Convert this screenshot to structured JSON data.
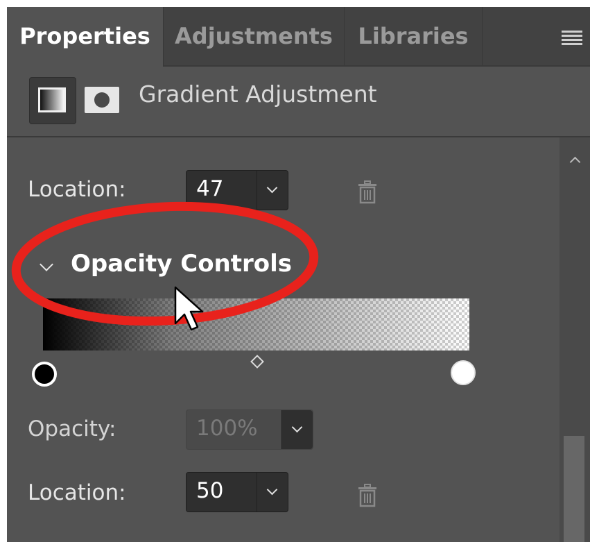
{
  "tabs": [
    {
      "label": "Properties",
      "active": true
    },
    {
      "label": "Adjustments",
      "active": false
    },
    {
      "label": "Libraries",
      "active": false
    }
  ],
  "tab_menu_icon": "hamburger-menu-icon",
  "adjustment": {
    "title": "Gradient Adjustment",
    "icons": [
      "gradient-adjustment-icon",
      "layer-mask-icon"
    ]
  },
  "color_stop": {
    "location_label": "Location:",
    "location_value": "47"
  },
  "opacity_section": {
    "title": "Opacity Controls",
    "expanded": true,
    "opacity_label": "Opacity:",
    "opacity_value": "100%",
    "opacity_disabled": true,
    "location_label": "Location:",
    "location_value": "50",
    "midpoint": 0.5
  },
  "colors": {
    "panel": "#535353",
    "tab_bar": "#424242",
    "annotation_ring": "#e8221c"
  }
}
